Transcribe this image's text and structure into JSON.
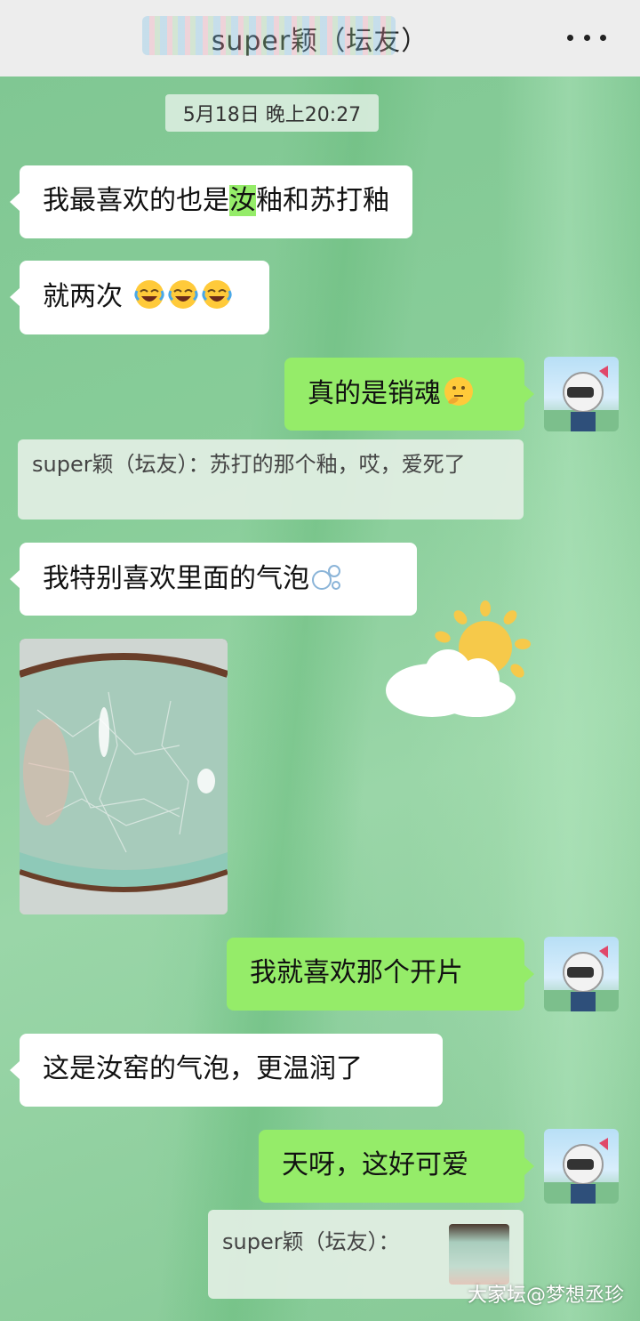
{
  "header": {
    "title": "super颖（坛友）"
  },
  "timestamp": "5月18日 晚上20:27",
  "messages": {
    "m1": {
      "before": "我最喜欢的也是",
      "highlight": "汝",
      "after": "釉和苏打釉"
    },
    "m2": {
      "text": "就两次",
      "emoji_name": "laughing-crying-emoji",
      "emoji_count": 3
    },
    "m3": {
      "text": "真的是销魂",
      "emoji_name": "thinking-emoji"
    },
    "m4_quote": "super颖（坛友）：苏打的那个釉，哎，爱死了",
    "m5": {
      "text": "我特别喜欢里面的气泡",
      "emoji_name": "bubbles-emoji"
    },
    "m6_image": "celadon-cup-photo",
    "m7": {
      "text": "我就喜欢那个开片"
    },
    "m8": {
      "text": "这是汝窑的气泡，更温润了"
    },
    "m9": {
      "text": "天呀，这好可爱"
    },
    "m10_quote": "super颖（坛友）："
  },
  "watermark": "大家坛@梦想丞珍",
  "colors": {
    "sent_bubble": "#95ec69",
    "received_bubble": "#ffffff",
    "header_bg": "#ededed"
  }
}
